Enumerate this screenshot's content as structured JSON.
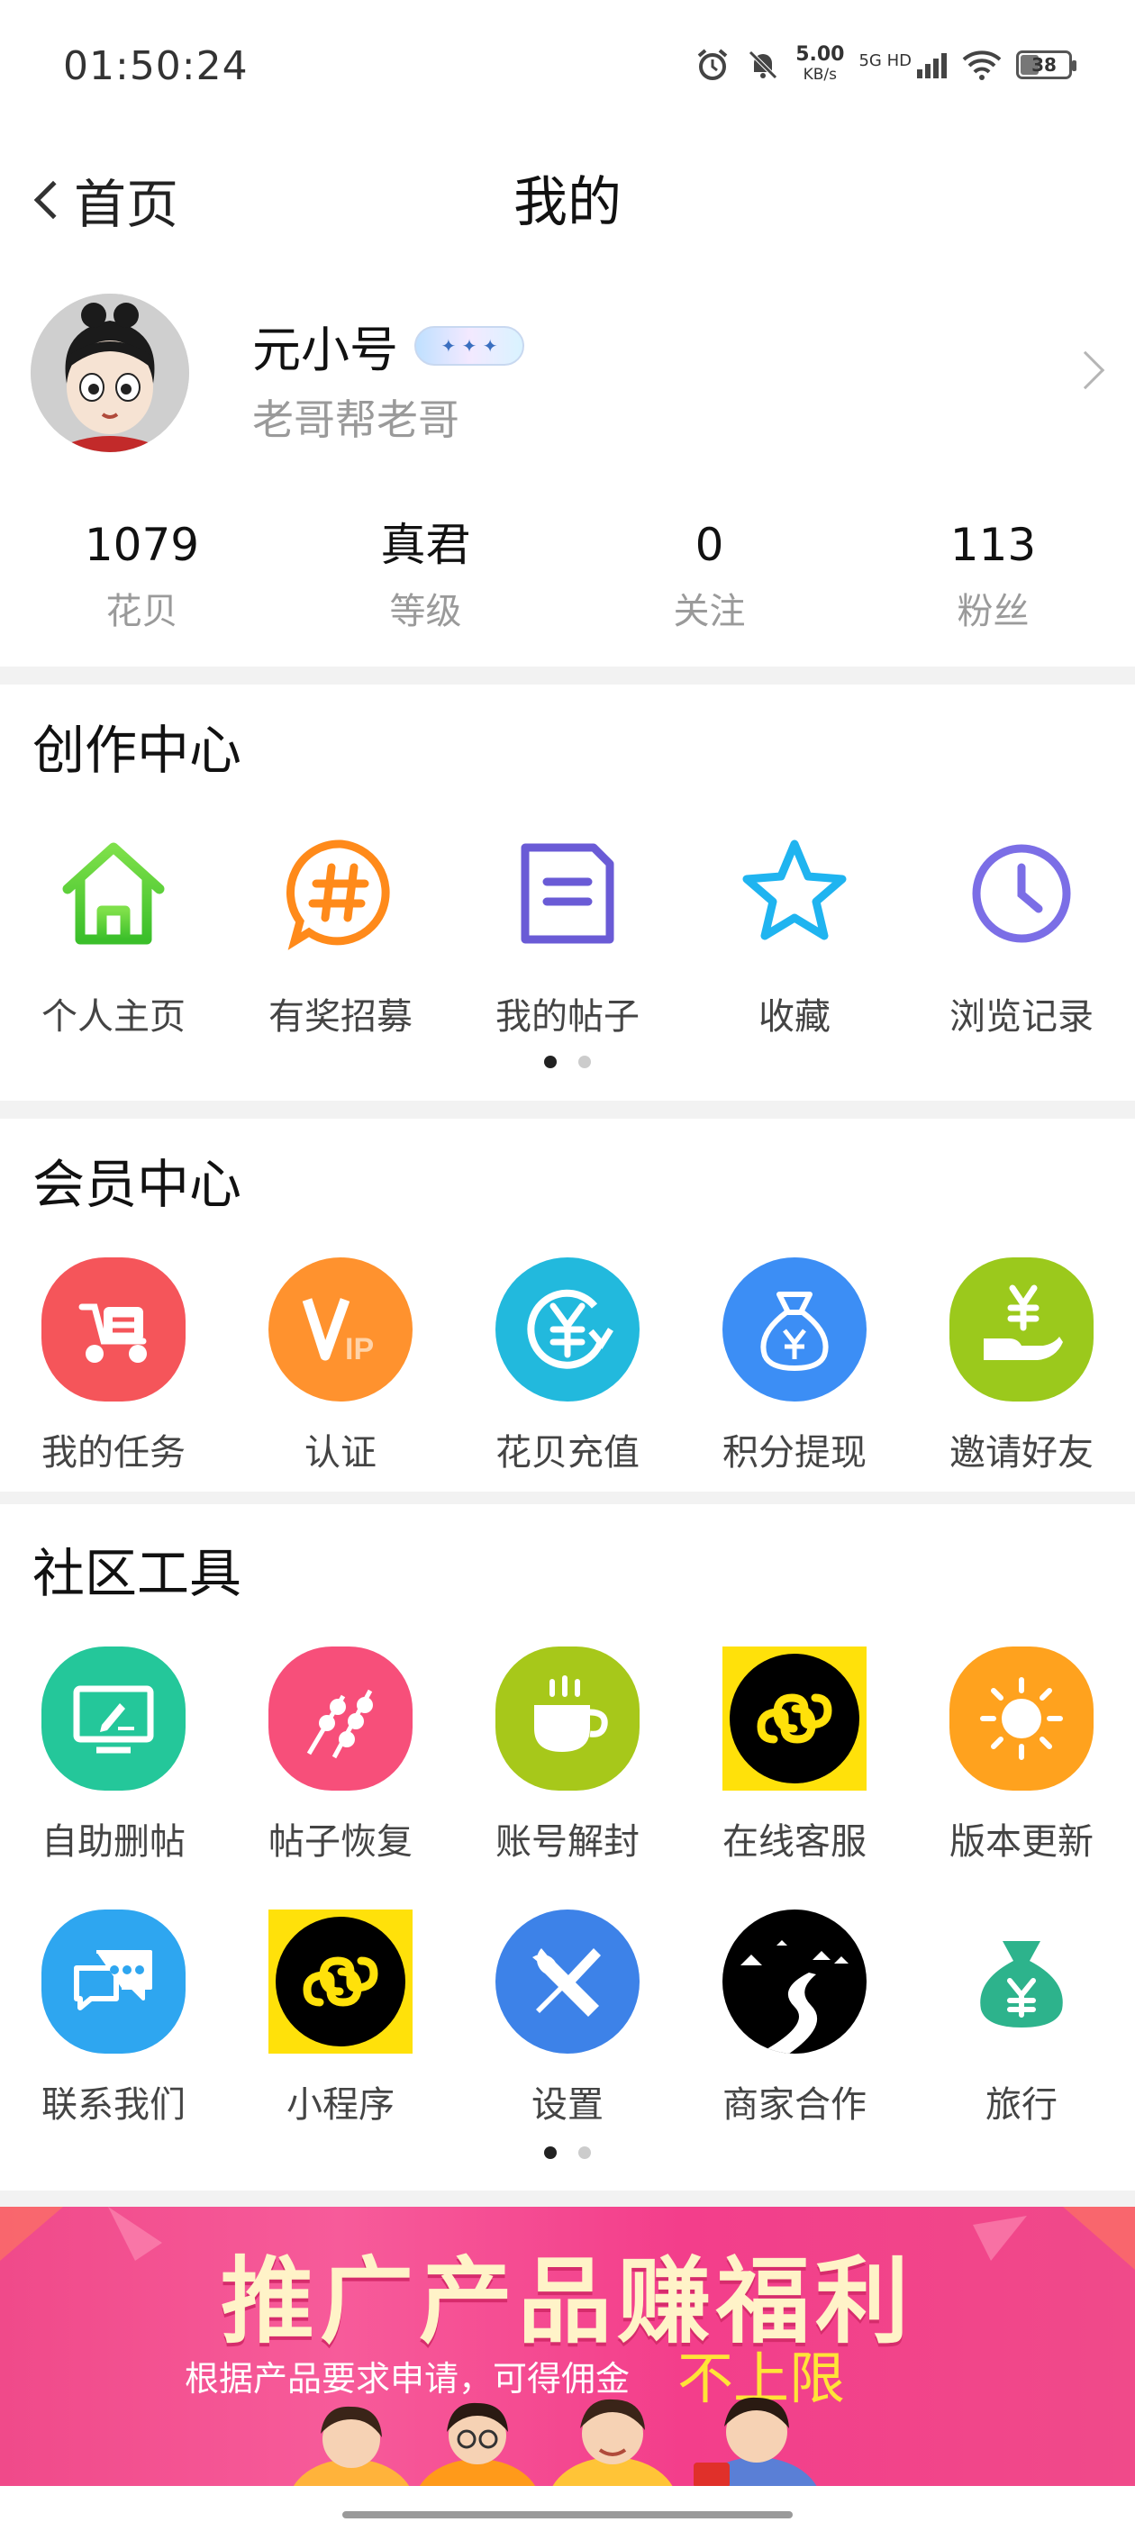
{
  "status_bar": {
    "time": "01:50:24",
    "speed_value": "5.00",
    "speed_unit": "KB/s",
    "network": "5G HD",
    "battery": "38"
  },
  "nav": {
    "back_label": "首页",
    "title": "我的"
  },
  "profile": {
    "name": "元小号",
    "subtitle": "老哥帮老哥"
  },
  "stats": [
    {
      "value": "1079",
      "label": "花贝"
    },
    {
      "value": "真君",
      "label": "等级"
    },
    {
      "value": "0",
      "label": "关注"
    },
    {
      "value": "113",
      "label": "粉丝"
    }
  ],
  "creation_center": {
    "title": "创作中心",
    "items": [
      {
        "label": "个人主页",
        "icon": "home-icon"
      },
      {
        "label": "有奖招募",
        "icon": "hashtag-icon"
      },
      {
        "label": "我的帖子",
        "icon": "document-icon"
      },
      {
        "label": "收藏",
        "icon": "star-icon"
      },
      {
        "label": "浏览记录",
        "icon": "clock-icon"
      }
    ]
  },
  "member_center": {
    "title": "会员中心",
    "items": [
      {
        "label": "我的任务",
        "icon": "scooter-icon",
        "color": "#f5555a"
      },
      {
        "label": "认证",
        "icon": "vip-icon",
        "color": "#ff922e"
      },
      {
        "label": "花贝充值",
        "icon": "yuan-refresh-icon",
        "color": "#22b9dd"
      },
      {
        "label": "积分提现",
        "icon": "money-bag-icon",
        "color": "#3c8ef5"
      },
      {
        "label": "邀请好友",
        "icon": "hand-yuan-icon",
        "color": "#9bc91c"
      }
    ]
  },
  "community_tools": {
    "title": "社区工具",
    "row1": [
      {
        "label": "自助删帖",
        "icon": "screen-pen-icon",
        "color": "#24c79a"
      },
      {
        "label": "帖子恢复",
        "icon": "skewers-icon",
        "color": "#f74f7a"
      },
      {
        "label": "账号解封",
        "icon": "cup-icon",
        "color": "#a7c81a"
      },
      {
        "label": "在线客服",
        "icon": "mini-program-icon",
        "color": "#ffe10a"
      },
      {
        "label": "版本更新",
        "icon": "sun-icon",
        "color": "#ffa21e"
      }
    ],
    "row2": [
      {
        "label": "联系我们",
        "icon": "chat-icon",
        "color": "#2ea6f0"
      },
      {
        "label": "小程序",
        "icon": "mini-program-icon",
        "color": "#ffe10a"
      },
      {
        "label": "设置",
        "icon": "wrench-screwdriver-icon",
        "color": "#3d82e8"
      },
      {
        "label": "商家合作",
        "icon": "road-icon",
        "color": "#000000"
      },
      {
        "label": "旅行",
        "icon": "money-bag-icon",
        "color": "#2db38c"
      }
    ]
  },
  "banner": {
    "title": "推广产品赚福利",
    "subtitle": "根据产品要求申请，可得佣金",
    "highlight": "不上限"
  }
}
